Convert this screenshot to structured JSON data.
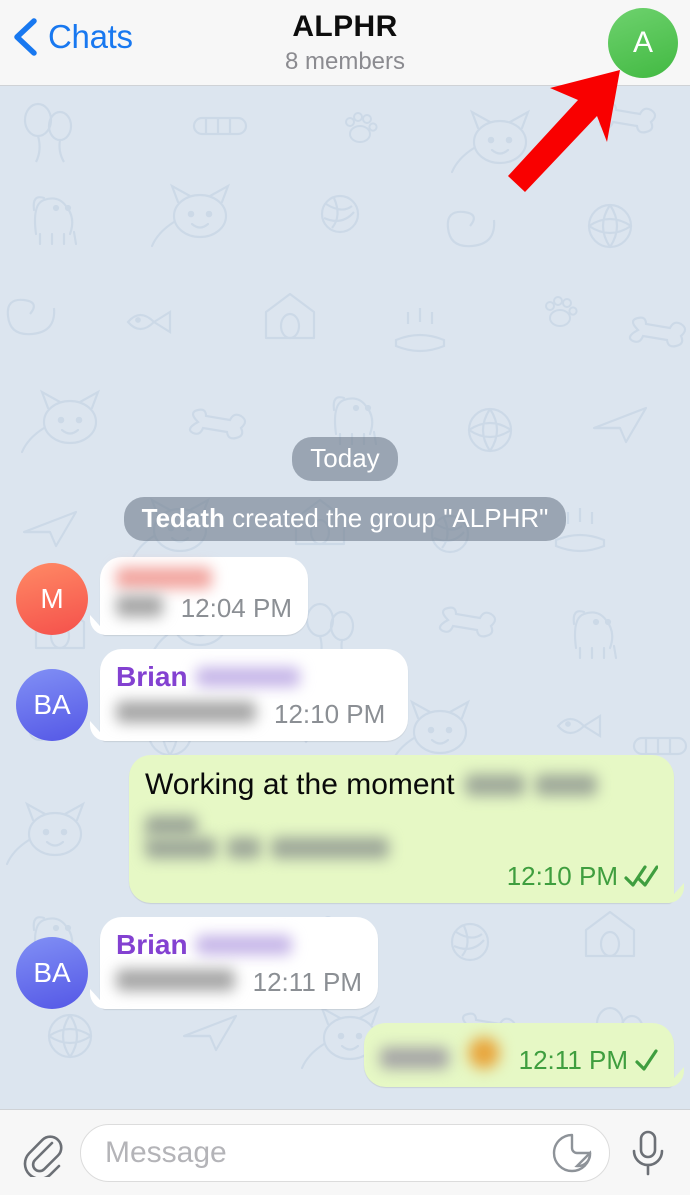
{
  "header": {
    "back_label": "Chats",
    "back_icon": "chevron-left-icon",
    "title": "ALPHR",
    "subtitle": "8 members",
    "avatar_initial": "A",
    "avatar_color": "#48bd48",
    "accent_color": "#1878f0"
  },
  "annotation": {
    "type": "arrow",
    "color": "#f90000",
    "points_to": "group-avatar"
  },
  "conversation": {
    "date_divider": "Today",
    "service_message": {
      "actor": "Tedath",
      "text": " created the group \"ALPHR\""
    },
    "messages": [
      {
        "id": "msg-1",
        "direction": "incoming",
        "avatar_initials": "M",
        "avatar_style": "red",
        "sender_redacted": true,
        "text_redacted": true,
        "time": "12:04 PM",
        "status": ""
      },
      {
        "id": "msg-2",
        "direction": "incoming",
        "avatar_initials": "BA",
        "avatar_style": "blue",
        "sender": "Brian",
        "sender_suffix_redacted": true,
        "text_redacted": true,
        "time": "12:10 PM",
        "status": ""
      },
      {
        "id": "msg-3",
        "direction": "outgoing",
        "text": "Working at the moment",
        "text_suffix_redacted": true,
        "second_line_redacted": true,
        "time": "12:10 PM",
        "status": "read",
        "status_icon": "double-check-icon"
      },
      {
        "id": "msg-4",
        "direction": "incoming",
        "avatar_initials": "BA",
        "avatar_style": "blue",
        "sender": "Brian",
        "sender_suffix_redacted": true,
        "text_redacted": true,
        "time": "12:11 PM",
        "status": ""
      },
      {
        "id": "msg-5",
        "direction": "outgoing",
        "text_redacted": true,
        "emoji_redacted": true,
        "time": "12:11 PM",
        "status": "sent",
        "status_icon": "single-check-icon"
      }
    ]
  },
  "composer": {
    "attach_icon": "paperclip-icon",
    "placeholder": "Message",
    "sticker_icon": "sticker-icon",
    "mic_icon": "microphone-icon"
  },
  "theme": {
    "chat_background": "#dce5ef",
    "bubble_in": "#ffffff",
    "bubble_out": "#e6f8c5",
    "sender_name_color": "#8341d1",
    "tick_color": "#3f9e3f"
  }
}
